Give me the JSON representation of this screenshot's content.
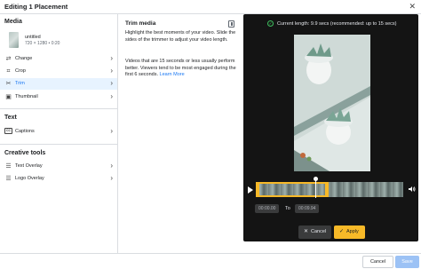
{
  "header": {
    "title": "Editing 1 Placement",
    "close_icon": "close-icon"
  },
  "media": {
    "heading": "Media",
    "file_name": "untitled",
    "file_meta": "720 × 1280 • 0:20"
  },
  "media_tools": [
    {
      "label": "Change",
      "icon": "swap-icon",
      "active": false
    },
    {
      "label": "Crop",
      "icon": "crop-icon",
      "active": false
    },
    {
      "label": "Trim",
      "icon": "scissors-icon",
      "active": true
    },
    {
      "label": "Thumbnail",
      "icon": "image-icon",
      "active": false
    }
  ],
  "text_section": {
    "heading": "Text",
    "items": [
      {
        "label": "Captions",
        "icon": "cc-icon"
      }
    ]
  },
  "creative_section": {
    "heading": "Creative tools",
    "items": [
      {
        "label": "Text Overlay",
        "icon": "text-overlay-icon"
      },
      {
        "label": "Logo Overlay",
        "icon": "logo-overlay-icon"
      }
    ]
  },
  "trim_panel": {
    "title": "Trim media",
    "paragraph1": "Highlight the best moments of your video. Slide the sides of the trimmer to adjust your video length.",
    "paragraph2_text": "Videos that are 15 seconds or less usually perform better. Viewers tend to be most engaged during the first 6 seconds.",
    "learn_more": "Learn More"
  },
  "editor": {
    "length_text": "Current length: 9.9 secs (recommended: up to 15 secs)",
    "start_time": "00:00.00",
    "to_label": "To",
    "end_time": "00:09.94",
    "cancel_label": "Cancel",
    "apply_label": "Apply",
    "trim_selection_fraction": 0.495,
    "playhead_fraction": 0.5
  },
  "footer": {
    "cancel_label": "Cancel",
    "save_label": "Save"
  },
  "colors": {
    "accent": "#1877f2",
    "trim_yellow": "#f7b928",
    "save_disabled": "#9cc2f5",
    "editor_bg": "#141414"
  }
}
